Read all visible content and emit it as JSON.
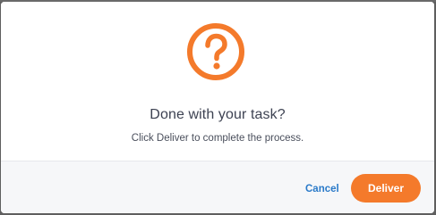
{
  "dialog": {
    "icon": "question-circle-icon",
    "title": "Done with your task?",
    "message": "Click Deliver to complete the process.",
    "cancel_label": "Cancel",
    "deliver_label": "Deliver"
  },
  "colors": {
    "accent": "#f47a2b",
    "link": "#2a7ac9",
    "title": "#3d4252",
    "footer_bg": "#f6f7f9",
    "overlay": "#5f5f5f"
  }
}
